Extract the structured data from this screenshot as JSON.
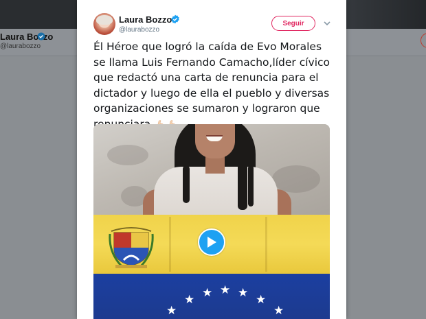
{
  "background_profile": {
    "name": "Laura Bozzo",
    "handle": "@laurabozzo"
  },
  "tweet": {
    "author_name": "Laura Bozzo",
    "author_handle": "@laurabozzo",
    "verified": true,
    "follow_label": "Seguir",
    "more_icon": "chevron-down-icon",
    "text": "Él Héroe que logró la caída de Evo Morales se llama Luis Fernando Camacho,líder cívico que redactó una carta de renuncia para el dictador y luego de ella el pueblo y diversas organizaciones se sumaron y lograron que renunciara",
    "emojis": [
      "flexed-biceps-icon",
      "flexed-biceps-icon"
    ],
    "media": {
      "type": "video",
      "play_icon": "play-icon"
    }
  },
  "colors": {
    "follow_accent": "#e0245e",
    "verified_blue": "#1da1f2",
    "play_blue": "#1da1f2",
    "text": "#14171a",
    "secondary_text": "#657786",
    "overlay": "#8a8e92"
  }
}
